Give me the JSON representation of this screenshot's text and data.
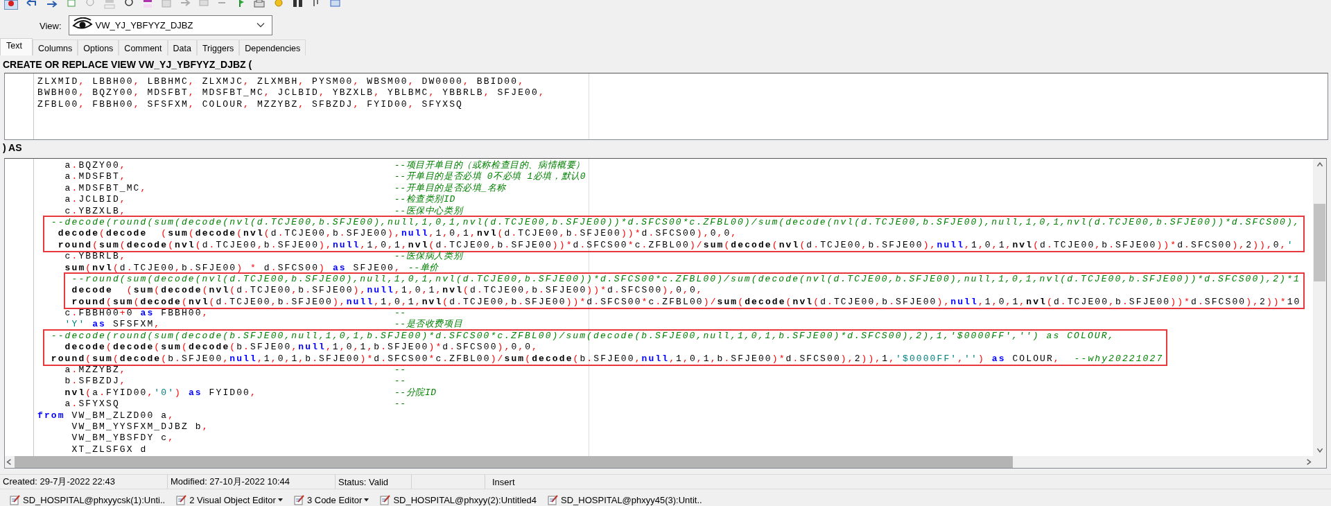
{
  "view_selector": {
    "label": "View:",
    "value": "VW_YJ_YBFYYZ_DJBZ"
  },
  "tabs": [
    {
      "label": "Text",
      "selected": true
    },
    {
      "label": "Columns",
      "selected": false
    },
    {
      "label": "Options",
      "selected": false
    },
    {
      "label": "Comment",
      "selected": false
    },
    {
      "label": "Data",
      "selected": false
    },
    {
      "label": "Triggers",
      "selected": false
    },
    {
      "label": "Dependencies",
      "selected": false
    }
  ],
  "header": "CREATE OR REPLACE VIEW VW_YJ_YBFYYZ_DJBZ (",
  "column_list": {
    "lines": [
      {
        "code": [
          {
            "kind": "plain",
            "text": "ZLXMID, LBBH00, LBBHMC, ZLXMJC, ZLXMBH, PYSM00, WBSM00, DW0000, BBID00,"
          }
        ]
      },
      {
        "code": [
          {
            "kind": "plain",
            "text": "BWBH00, BQZY00, MDSFBT, MDSFBT_MC, JCLBID, YBZXLB, YBLBMC, YBBRLB, SFJE00,"
          }
        ]
      },
      {
        "code": [
          {
            "kind": "plain",
            "text": "ZFBL00, FBBH00, SFSFXM, COLOUR, MZZYBZ, SFBZDJ, FYID00, SFYXSQ"
          }
        ]
      }
    ]
  },
  "as_label": ") AS",
  "editor": {
    "blocks": [
      {
        "boxed": false,
        "lines": [
          {
            "code": [
              {
                "kind": "plain",
                "text": "    a.BQZY00,"
              }
            ],
            "comment": "--项目开单目的（或称检查目的、病情概要）"
          },
          {
            "code": [
              {
                "kind": "plain",
                "text": "    a.MDSFBT,"
              }
            ],
            "comment": "--开单目的是否必填 0不必填 1必填，默认0"
          },
          {
            "code": [
              {
                "kind": "plain",
                "text": "    a.MDSFBT_MC,"
              }
            ],
            "comment": "--开单目的是否必填_名称"
          },
          {
            "code": [
              {
                "kind": "plain",
                "text": "    a.JCLBID,"
              }
            ],
            "comment": "--检查类别ID"
          },
          {
            "code": [
              {
                "kind": "plain",
                "text": "    c.YBZXLB,"
              }
            ],
            "comment": "--医保中心类别"
          }
        ]
      },
      {
        "boxed": true,
        "lines": [
          {
            "code": [
              {
                "kind": "comment",
                "text": "  --decode(round(sum(decode(nvl(d.TCJE00,b.SFJE00),null,1,0,1,nvl(d.TCJE00,b.SFJE00))*d.SFCS00*c.ZFBL00)/sum(decode(nvl(d.TCJE00,b.SFJE00),null,1,0,1,nvl(d.TCJE00,b.SFJE00))*d.SFCS00),"
              }
            ]
          },
          {
            "code": [
              {
                "kind": "function",
                "text": "   decode"
              },
              {
                "kind": "plain",
                "text": "("
              },
              {
                "kind": "function",
                "text": "decode"
              },
              {
                "kind": "plain",
                "text": "  ("
              },
              {
                "kind": "function",
                "text": "sum"
              },
              {
                "kind": "plain",
                "text": "("
              },
              {
                "kind": "function",
                "text": "decode"
              },
              {
                "kind": "plain",
                "text": "("
              },
              {
                "kind": "function",
                "text": "nvl"
              },
              {
                "kind": "plain",
                "text": "(d.TCJE00,b.SFJE00),"
              },
              {
                "kind": "keyword",
                "text": "null"
              },
              {
                "kind": "plain",
                "text": ",1,0,1,"
              },
              {
                "kind": "function",
                "text": "nvl"
              },
              {
                "kind": "plain",
                "text": "(d.TCJE00,b.SFJE00))*d.SFCS00),0,0,"
              }
            ]
          },
          {
            "code": [
              {
                "kind": "function",
                "text": "   round"
              },
              {
                "kind": "plain",
                "text": "("
              },
              {
                "kind": "function",
                "text": "sum"
              },
              {
                "kind": "plain",
                "text": "("
              },
              {
                "kind": "function",
                "text": "decode"
              },
              {
                "kind": "plain",
                "text": "("
              },
              {
                "kind": "function",
                "text": "nvl"
              },
              {
                "kind": "plain",
                "text": "(d.TCJE00,b.SFJE00),"
              },
              {
                "kind": "keyword",
                "text": "null"
              },
              {
                "kind": "plain",
                "text": ",1,0,1,"
              },
              {
                "kind": "function",
                "text": "nvl"
              },
              {
                "kind": "plain",
                "text": "(d.TCJE00,b.SFJE00))*d.SFCS00*c.ZFBL00)/"
              },
              {
                "kind": "function",
                "text": "sum"
              },
              {
                "kind": "plain",
                "text": "("
              },
              {
                "kind": "function",
                "text": "decode"
              },
              {
                "kind": "plain",
                "text": "("
              },
              {
                "kind": "function",
                "text": "nvl"
              },
              {
                "kind": "plain",
                "text": "(d.TCJE00,b.SFJE00),"
              },
              {
                "kind": "keyword",
                "text": "null"
              },
              {
                "kind": "plain",
                "text": ",1,0,1,"
              },
              {
                "kind": "function",
                "text": "nvl"
              },
              {
                "kind": "plain",
                "text": "(d.TCJE00,b.SFJE00))*d.SFCS00),2)),0,"
              },
              {
                "kind": "string",
                "text": "'"
              }
            ]
          }
        ]
      },
      {
        "boxed": false,
        "lines": [
          {
            "code": [
              {
                "kind": "plain",
                "text": "    c.YBBRLB,"
              }
            ],
            "comment": "--医保病人类别"
          },
          {
            "code": [
              {
                "kind": "function",
                "text": "    sum"
              },
              {
                "kind": "plain",
                "text": "("
              },
              {
                "kind": "function",
                "text": "nvl"
              },
              {
                "kind": "plain",
                "text": "(d.TCJE00,b.SFJE00) * d.SFCS00) "
              },
              {
                "kind": "keyword",
                "text": "as"
              },
              {
                "kind": "plain",
                "text": " SFJE00,"
              }
            ],
            "comment": "--单价"
          }
        ]
      },
      {
        "boxed": true,
        "lines": [
          {
            "code": [
              {
                "kind": "comment",
                "text": "     --round(sum(decode(nvl(d.TCJE00,b.SFJE00),null,1,0,1,nvl(d.TCJE00,b.SFJE00))*d.SFCS00*c.ZFBL00)/sum(decode(nvl(d.TCJE00,b.SFJE00),null,1,0,1,nvl(d.TCJE00,b.SFJE00))*d.SFCS00),2)*1"
              }
            ]
          },
          {
            "code": [
              {
                "kind": "function",
                "text": "     decode"
              },
              {
                "kind": "plain",
                "text": "  ("
              },
              {
                "kind": "function",
                "text": "sum"
              },
              {
                "kind": "plain",
                "text": "("
              },
              {
                "kind": "function",
                "text": "decode"
              },
              {
                "kind": "plain",
                "text": "("
              },
              {
                "kind": "function",
                "text": "nvl"
              },
              {
                "kind": "plain",
                "text": "(d.TCJE00,b.SFJE00),"
              },
              {
                "kind": "keyword",
                "text": "null"
              },
              {
                "kind": "plain",
                "text": ",1,0,1,"
              },
              {
                "kind": "function",
                "text": "nvl"
              },
              {
                "kind": "plain",
                "text": "(d.TCJE00,b.SFJE00))*d.SFCS00),0,0,"
              }
            ]
          },
          {
            "code": [
              {
                "kind": "function",
                "text": "     round"
              },
              {
                "kind": "plain",
                "text": "("
              },
              {
                "kind": "function",
                "text": "sum"
              },
              {
                "kind": "plain",
                "text": "("
              },
              {
                "kind": "function",
                "text": "decode"
              },
              {
                "kind": "plain",
                "text": "("
              },
              {
                "kind": "function",
                "text": "nvl"
              },
              {
                "kind": "plain",
                "text": "(d.TCJE00,b.SFJE00),"
              },
              {
                "kind": "keyword",
                "text": "null"
              },
              {
                "kind": "plain",
                "text": ",1,0,1,"
              },
              {
                "kind": "function",
                "text": "nvl"
              },
              {
                "kind": "plain",
                "text": "(d.TCJE00,b.SFJE00))*d.SFCS00*c.ZFBL00)/"
              },
              {
                "kind": "function",
                "text": "sum"
              },
              {
                "kind": "plain",
                "text": "("
              },
              {
                "kind": "function",
                "text": "decode"
              },
              {
                "kind": "plain",
                "text": "("
              },
              {
                "kind": "function",
                "text": "nvl"
              },
              {
                "kind": "plain",
                "text": "(d.TCJE00,b.SFJE00),"
              },
              {
                "kind": "keyword",
                "text": "null"
              },
              {
                "kind": "plain",
                "text": ",1,0,1,"
              },
              {
                "kind": "function",
                "text": "nvl"
              },
              {
                "kind": "plain",
                "text": "(d.TCJE00,b.SFJE00))*d.SFCS00),2))*10"
              }
            ]
          }
        ]
      },
      {
        "boxed": false,
        "lines": [
          {
            "code": [
              {
                "kind": "plain",
                "text": "    c.FBBH00+0 "
              },
              {
                "kind": "keyword",
                "text": "as"
              },
              {
                "kind": "plain",
                "text": " FBBH00,"
              }
            ],
            "comment": "--"
          },
          {
            "code": [
              {
                "kind": "string",
                "text": "    'Y' "
              },
              {
                "kind": "keyword",
                "text": "as"
              },
              {
                "kind": "plain",
                "text": " SFSFXM,"
              }
            ],
            "comment": "--是否收费项目"
          }
        ]
      },
      {
        "boxed": true,
        "lines": [
          {
            "code": [
              {
                "kind": "comment",
                "text": "  --decode(round(sum(decode(b.SFJE00,null,1,0,1,b.SFJE00)*d.SFCS00*c.ZFBL00)/sum(decode(b.SFJE00,null,1,0,1,b.SFJE00)*d.SFCS00),2),1,'$0000FF','') as COLOUR,"
              }
            ]
          },
          {
            "code": [
              {
                "kind": "function",
                "text": "    decode"
              },
              {
                "kind": "plain",
                "text": "("
              },
              {
                "kind": "function",
                "text": "decode"
              },
              {
                "kind": "plain",
                "text": "("
              },
              {
                "kind": "function",
                "text": "sum"
              },
              {
                "kind": "plain",
                "text": "("
              },
              {
                "kind": "function",
                "text": "decode"
              },
              {
                "kind": "plain",
                "text": "(b.SFJE00,"
              },
              {
                "kind": "keyword",
                "text": "null"
              },
              {
                "kind": "plain",
                "text": ",1,0,1,b.SFJE00)*d.SFCS00),0,0,"
              }
            ]
          },
          {
            "code": [
              {
                "kind": "function",
                "text": "  round"
              },
              {
                "kind": "plain",
                "text": "("
              },
              {
                "kind": "function",
                "text": "sum"
              },
              {
                "kind": "plain",
                "text": "("
              },
              {
                "kind": "function",
                "text": "decode"
              },
              {
                "kind": "plain",
                "text": "(b.SFJE00,"
              },
              {
                "kind": "keyword",
                "text": "null"
              },
              {
                "kind": "plain",
                "text": ",1,0,1,b.SFJE00)*d.SFCS00*c.ZFBL00)/"
              },
              {
                "kind": "function",
                "text": "sum"
              },
              {
                "kind": "plain",
                "text": "("
              },
              {
                "kind": "function",
                "text": "decode"
              },
              {
                "kind": "plain",
                "text": "(b.SFJE00,"
              },
              {
                "kind": "keyword",
                "text": "null"
              },
              {
                "kind": "plain",
                "text": ",1,0,1,b.SFJE00)*d.SFCS00),2)),1,"
              },
              {
                "kind": "string",
                "text": "'$0000FF'"
              },
              {
                "kind": "plain",
                "text": ","
              },
              {
                "kind": "string",
                "text": "''"
              },
              {
                "kind": "plain",
                "text": ") "
              },
              {
                "kind": "keyword",
                "text": "as"
              },
              {
                "kind": "plain",
                "text": " COLOUR,  "
              },
              {
                "kind": "comment",
                "text": "--why20221027"
              }
            ]
          }
        ]
      },
      {
        "boxed": false,
        "lines": [
          {
            "code": [
              {
                "kind": "plain",
                "text": "    a.MZZYBZ,"
              }
            ],
            "comment": "--"
          },
          {
            "code": [
              {
                "kind": "plain",
                "text": "    b.SFBZDJ,"
              }
            ],
            "comment": "--"
          },
          {
            "code": [
              {
                "kind": "function",
                "text": "    nvl"
              },
              {
                "kind": "plain",
                "text": "(a.FYID00,"
              },
              {
                "kind": "string",
                "text": "'0'"
              },
              {
                "kind": "plain",
                "text": ") "
              },
              {
                "kind": "keyword",
                "text": "as"
              },
              {
                "kind": "plain",
                "text": " FYID00,"
              }
            ],
            "comment": "--分院ID"
          },
          {
            "code": [
              {
                "kind": "plain",
                "text": "    a.SFYXSQ"
              }
            ],
            "comment": "--"
          },
          {
            "code": [
              {
                "kind": "keyword",
                "text": "from"
              },
              {
                "kind": "plain",
                "text": " VW_BM_ZLZD00 a,"
              }
            ]
          },
          {
            "code": [
              {
                "kind": "plain",
                "text": "     VW_BM_YYSFXM_DJBZ b,"
              }
            ]
          },
          {
            "code": [
              {
                "kind": "plain",
                "text": "     VW_BM_YBSFDY c,"
              }
            ]
          },
          {
            "code": [
              {
                "kind": "plain",
                "text": "     XT_ZLSFGX d"
              }
            ]
          }
        ]
      }
    ]
  },
  "status_bar": {
    "fields": [
      "Created: 29-7月-2022 22:43",
      "Modified: 27-10月-2022 10:44",
      "Status: Valid",
      "Insert"
    ]
  },
  "taskbar": {
    "items": [
      {
        "label": "SD_HOSPITAL@phxyycsk(1):Unti..",
        "dropdown": false
      },
      {
        "label": "2 Visual Object Editor",
        "dropdown": true
      },
      {
        "label": "3 Code Editor",
        "dropdown": true
      },
      {
        "label": "SD_HOSPITAL@phxyy(2):Untitled4",
        "dropdown": false
      },
      {
        "label": "SD_HOSPITAL@phxyy45(3):Untit..",
        "dropdown": false
      }
    ]
  }
}
